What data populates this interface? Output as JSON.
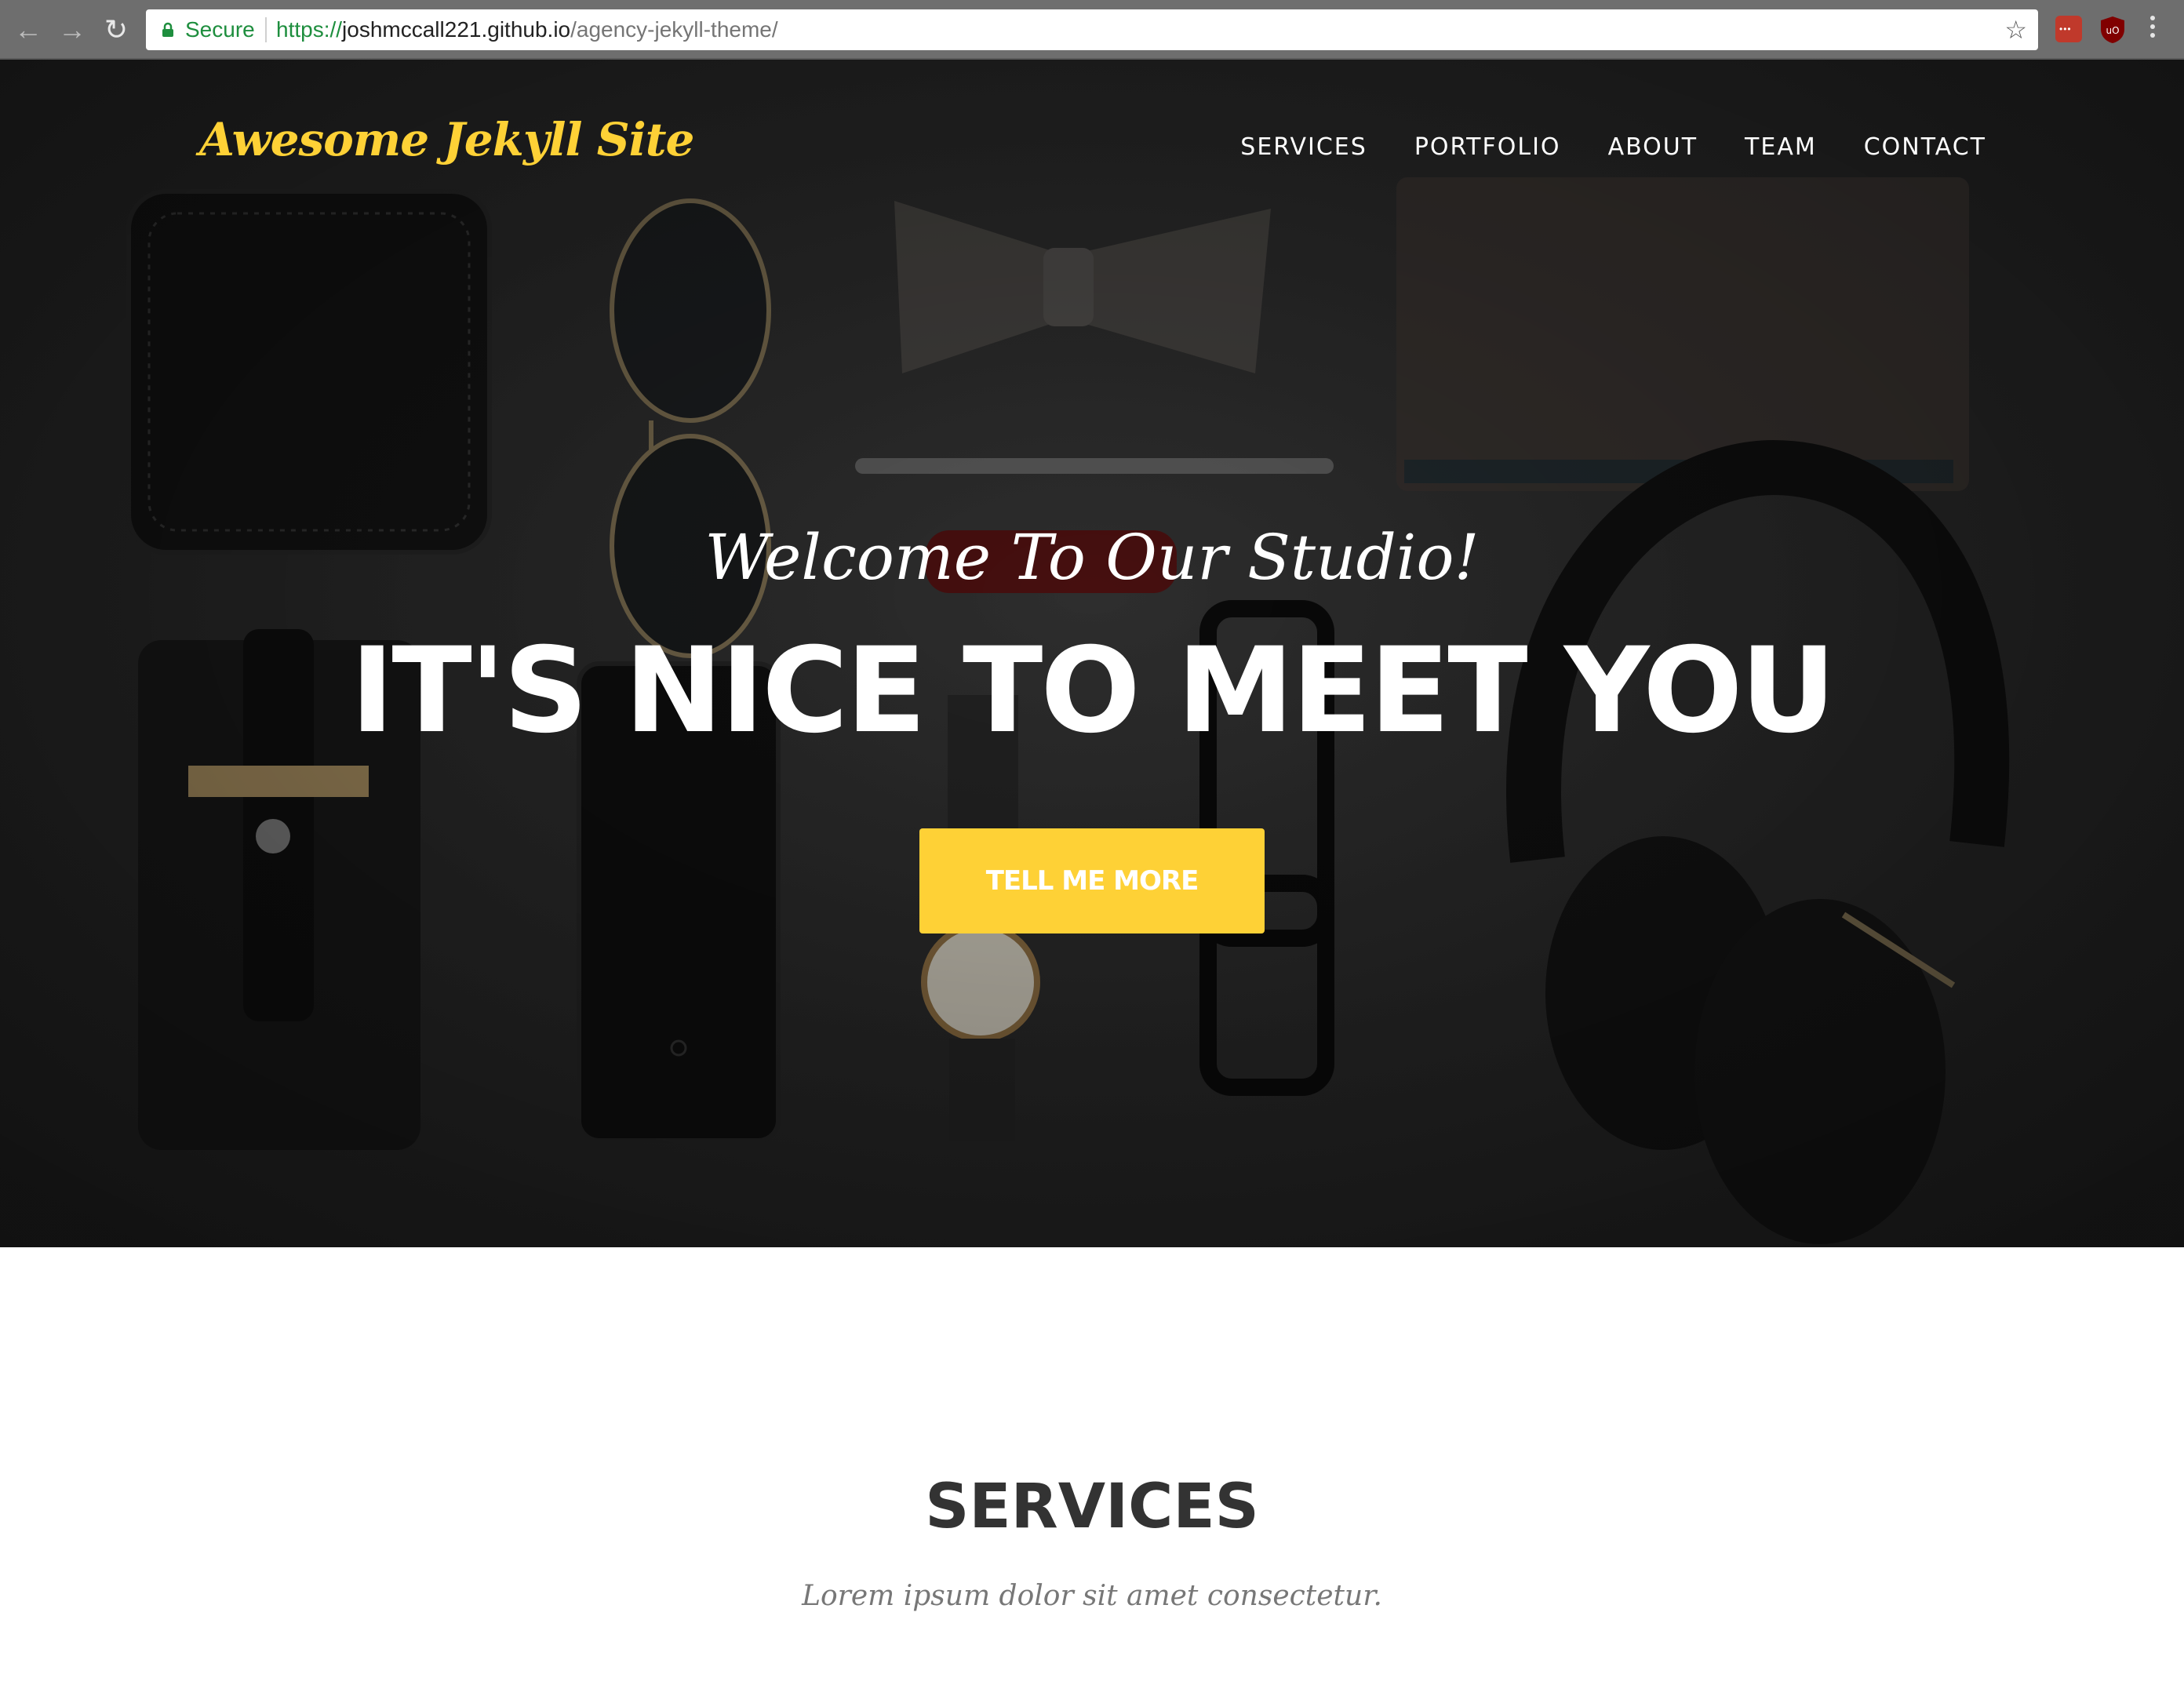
{
  "browser": {
    "secure_label": "Secure",
    "url_scheme": "https://",
    "url_host": "joshmccall221.github.io",
    "url_path": "/agency-jekyll-theme/",
    "back_icon": "back-arrow-icon",
    "forward_icon": "forward-arrow-icon",
    "reload_icon": "reload-icon",
    "bookmark_icon": "star-icon",
    "menu_icon": "kebab-menu-icon",
    "extensions": [
      "lastpass-icon",
      "ublock-icon"
    ]
  },
  "navbar": {
    "brand": "Awesome Jekyll Site",
    "items": [
      {
        "label": "SERVICES"
      },
      {
        "label": "PORTFOLIO"
      },
      {
        "label": "ABOUT"
      },
      {
        "label": "TEAM"
      },
      {
        "label": "CONTACT"
      }
    ]
  },
  "hero": {
    "subheading": "Welcome To Our Studio!",
    "heading": "IT'S NICE TO MEET YOU",
    "button_label": "TELL ME MORE"
  },
  "services": {
    "heading": "SERVICES",
    "subheading": "Lorem ipsum dolor sit amet consectetur."
  },
  "colors": {
    "accent": "#fed136",
    "hero_overlay": "#2d2d2d",
    "heading_text": "#333333",
    "muted_text": "#777777",
    "secure_green": "#1e8e3e"
  }
}
